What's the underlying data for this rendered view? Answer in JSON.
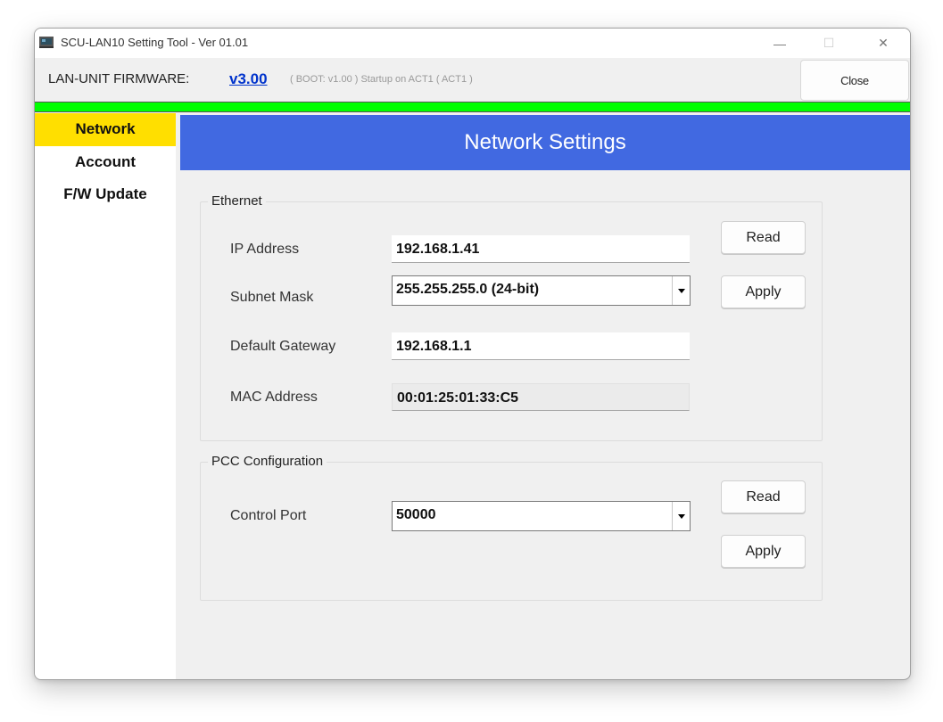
{
  "window": {
    "title": "SCU-LAN10 Setting Tool - Ver 01.01",
    "controls": {
      "minimize": "—",
      "maximize": "☐",
      "close": "✕"
    }
  },
  "header": {
    "firmware_label": "LAN-UNIT FIRMWARE:",
    "firmware_version": "v3.00",
    "boot_info": "( BOOT: v1.00 ) Startup on ACT1 ( ACT1 )",
    "close_button": "Close",
    "status_color": "#00ff00"
  },
  "sidebar": {
    "items": [
      {
        "label": "Network",
        "active": true
      },
      {
        "label": "Account",
        "active": false
      },
      {
        "label": "F/W Update",
        "active": false
      }
    ]
  },
  "main": {
    "title": "Network Settings",
    "ethernet": {
      "group_label": "Ethernet",
      "ip_label": "IP Address",
      "ip_value": "192.168.1.41",
      "subnet_label": "Subnet Mask",
      "subnet_value": "255.255.255.0 (24-bit)",
      "gateway_label": "Default Gateway",
      "gateway_value": "192.168.1.1",
      "mac_label": "MAC Address",
      "mac_value": "00:01:25:01:33:C5",
      "read_button": "Read",
      "apply_button": "Apply"
    },
    "pcc": {
      "group_label": "PCC Configuration",
      "port_label": "Control Port",
      "port_value": "50000",
      "read_button": "Read",
      "apply_button": "Apply"
    }
  }
}
